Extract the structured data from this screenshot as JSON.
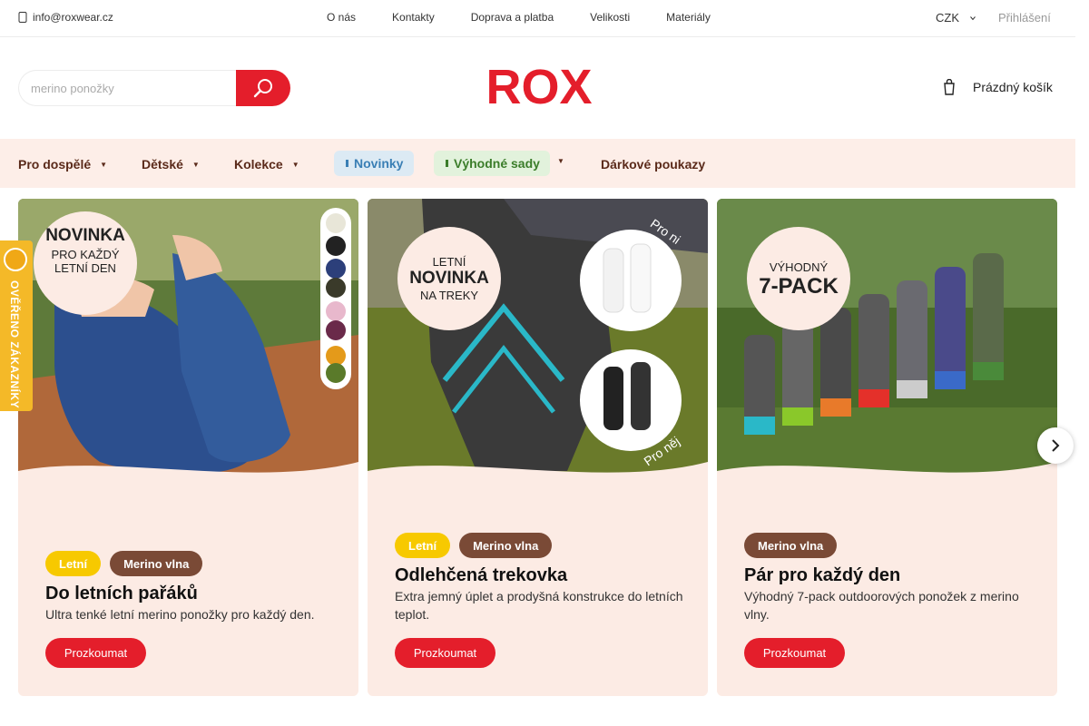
{
  "topbar": {
    "email": "info@roxwear.cz",
    "links": [
      "O nás",
      "Kontakty",
      "Doprava a platba",
      "Velikosti",
      "Materiály"
    ],
    "currency": "CZK",
    "login": "Přihlášení"
  },
  "header": {
    "search_placeholder": "merino ponožky",
    "logo_text": "ROX",
    "cart_label": "Prázdný košík"
  },
  "nav": {
    "items": [
      "Pro dospělé",
      "Dětské",
      "Kolekce"
    ],
    "new_label": "Novinky",
    "deals_label": "Výhodné sady",
    "gift_label": "Dárkové poukazy"
  },
  "badge": {
    "text": "OVĚŘENO ZÁKAZNÍKY"
  },
  "cards": [
    {
      "badge_lines": [
        "NOVINKA",
        "PRO KAŽDÝ",
        "LETNÍ DEN"
      ],
      "tags": [
        "Letní",
        "Merino vlna"
      ],
      "title": "Do letních pařáků",
      "text": "Ultra tenké letní merino ponožky pro každý den.",
      "button": "Prozkoumat"
    },
    {
      "badge_lines": [
        "LETNÍ",
        "NOVINKA",
        "NA TREKY"
      ],
      "image_labels": [
        "Pro ni",
        "Pro něj"
      ],
      "tags": [
        "Letní",
        "Merino vlna"
      ],
      "title": "Odlehčená trekovka",
      "text": "Extra jemný úplet a prodyšná konstrukce do letních teplot.",
      "button": "Prozkoumat"
    },
    {
      "badge_lines": [
        "VÝHODNÝ",
        "7-PACK"
      ],
      "tags": [
        "Merino vlna"
      ],
      "title": "Pár pro každý den",
      "text": "Výhodný 7-pack outdoorových ponožek z merino vlny.",
      "button": "Prozkoumat"
    }
  ],
  "colors": {
    "accent": "#e41e2b",
    "nav_bg": "#fdeee8",
    "card_bg": "#fcebe4",
    "tag_yellow": "#f7c900",
    "tag_brown": "#7a4a36",
    "badge": "#f4b928"
  }
}
